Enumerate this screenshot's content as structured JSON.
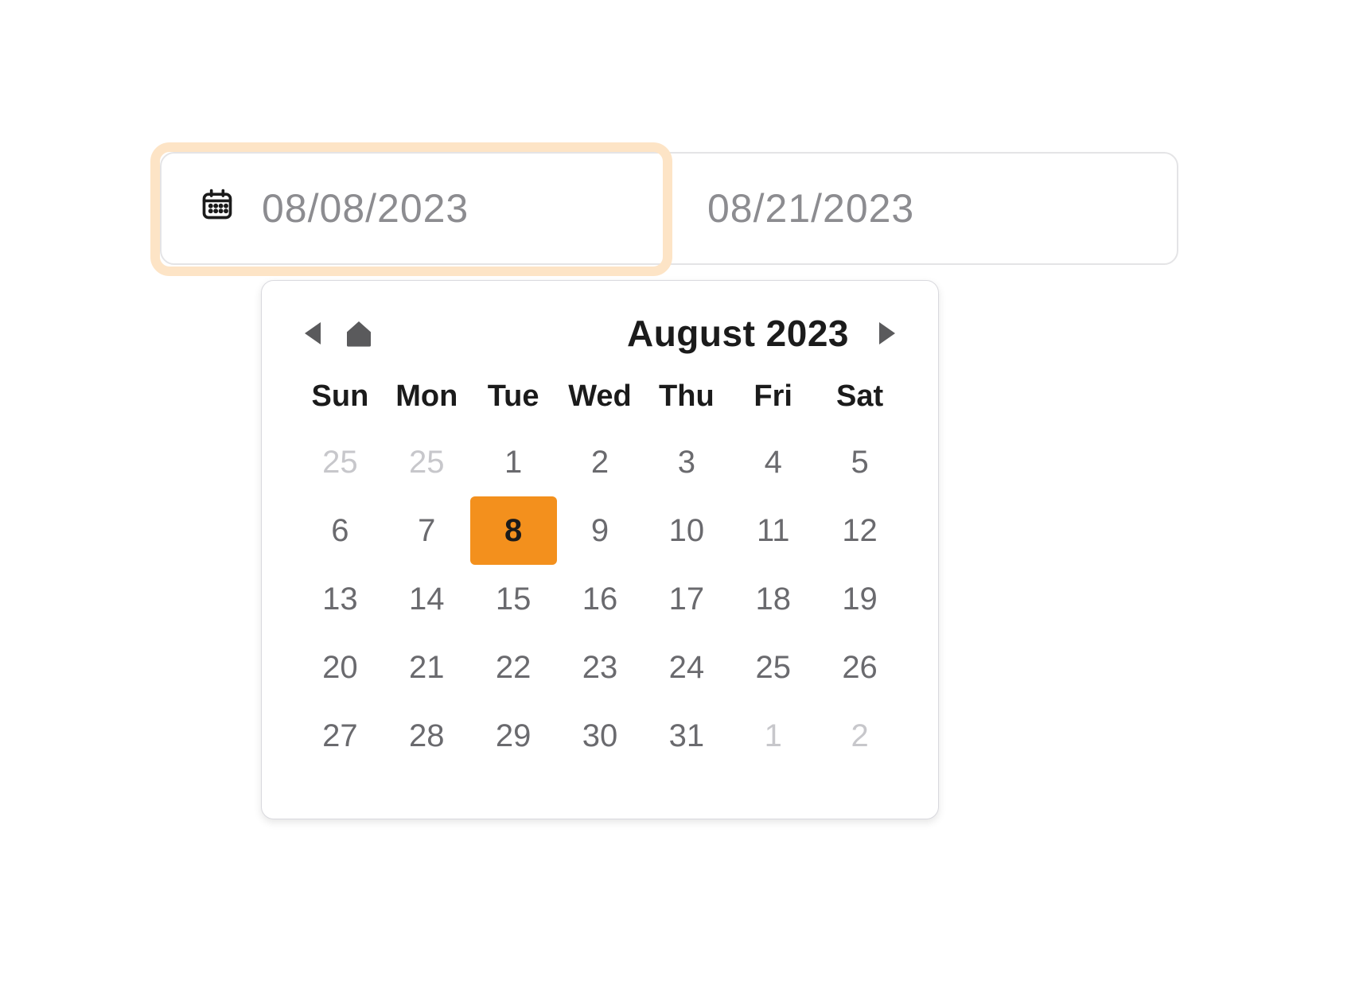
{
  "range": {
    "start_value": "08/08/2023",
    "end_value": "08/21/2023"
  },
  "calendar": {
    "month_label": "August 2023",
    "weekdays": [
      "Sun",
      "Mon",
      "Tue",
      "Wed",
      "Thu",
      "Fri",
      "Sat"
    ],
    "weeks": [
      [
        {
          "d": "25",
          "other": true,
          "sel": false
        },
        {
          "d": "25",
          "other": true,
          "sel": false
        },
        {
          "d": "1",
          "other": false,
          "sel": false
        },
        {
          "d": "2",
          "other": false,
          "sel": false
        },
        {
          "d": "3",
          "other": false,
          "sel": false
        },
        {
          "d": "4",
          "other": false,
          "sel": false
        },
        {
          "d": "5",
          "other": false,
          "sel": false
        }
      ],
      [
        {
          "d": "6",
          "other": false,
          "sel": false
        },
        {
          "d": "7",
          "other": false,
          "sel": false
        },
        {
          "d": "8",
          "other": false,
          "sel": true
        },
        {
          "d": "9",
          "other": false,
          "sel": false
        },
        {
          "d": "10",
          "other": false,
          "sel": false
        },
        {
          "d": "11",
          "other": false,
          "sel": false
        },
        {
          "d": "12",
          "other": false,
          "sel": false
        }
      ],
      [
        {
          "d": "13",
          "other": false,
          "sel": false
        },
        {
          "d": "14",
          "other": false,
          "sel": false
        },
        {
          "d": "15",
          "other": false,
          "sel": false
        },
        {
          "d": "16",
          "other": false,
          "sel": false
        },
        {
          "d": "17",
          "other": false,
          "sel": false
        },
        {
          "d": "18",
          "other": false,
          "sel": false
        },
        {
          "d": "19",
          "other": false,
          "sel": false
        }
      ],
      [
        {
          "d": "20",
          "other": false,
          "sel": false
        },
        {
          "d": "21",
          "other": false,
          "sel": false
        },
        {
          "d": "22",
          "other": false,
          "sel": false
        },
        {
          "d": "23",
          "other": false,
          "sel": false
        },
        {
          "d": "24",
          "other": false,
          "sel": false
        },
        {
          "d": "25",
          "other": false,
          "sel": false
        },
        {
          "d": "26",
          "other": false,
          "sel": false
        }
      ],
      [
        {
          "d": "27",
          "other": false,
          "sel": false
        },
        {
          "d": "28",
          "other": false,
          "sel": false
        },
        {
          "d": "29",
          "other": false,
          "sel": false
        },
        {
          "d": "30",
          "other": false,
          "sel": false
        },
        {
          "d": "31",
          "other": false,
          "sel": false
        },
        {
          "d": "1",
          "other": true,
          "sel": false
        },
        {
          "d": "2",
          "other": true,
          "sel": false
        }
      ]
    ]
  },
  "colors": {
    "accent": "#f3901d",
    "focus_ring": "#fde4c6"
  }
}
